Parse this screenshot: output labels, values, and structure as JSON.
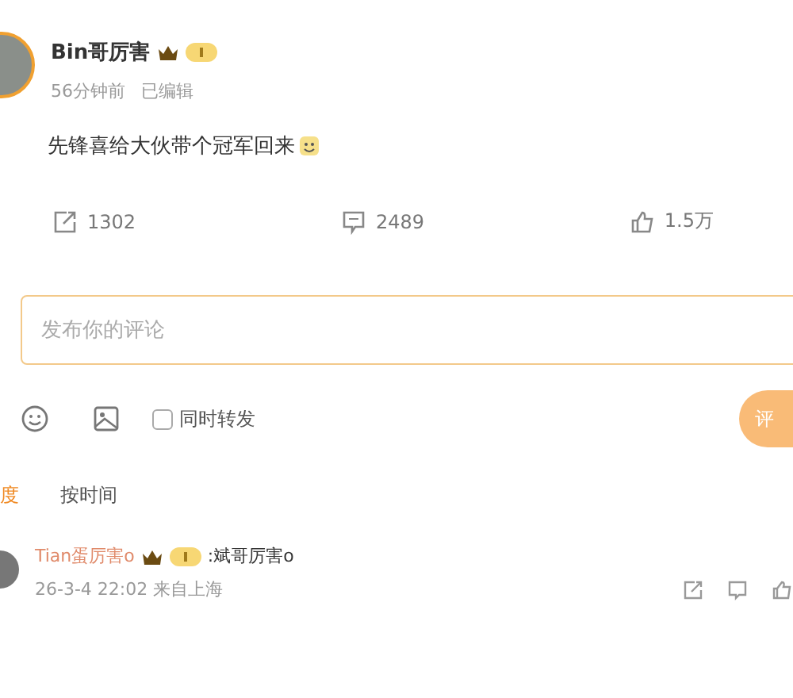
{
  "post": {
    "author": "Bin哥厉害",
    "time": "56分钟前",
    "edited": "已编辑",
    "content": "先锋喜给大伙带个冠军回来",
    "actions": [
      {
        "kind": "repost",
        "count": "1302"
      },
      {
        "kind": "comment",
        "count": "2489"
      },
      {
        "kind": "like",
        "count": "1.5万"
      }
    ]
  },
  "composer": {
    "placeholder": "发布你的评论",
    "repost_label": "同时转发",
    "repost_checked": false,
    "submit": "评"
  },
  "sort_tabs": [
    {
      "label": "度",
      "selected": true
    },
    {
      "label": "按时间",
      "selected": false
    }
  ],
  "comments": [
    {
      "author": "Tian蛋厉害o",
      "text": ":斌哥厉害o",
      "time": "26-3-4 22:02 来自上海"
    }
  ]
}
